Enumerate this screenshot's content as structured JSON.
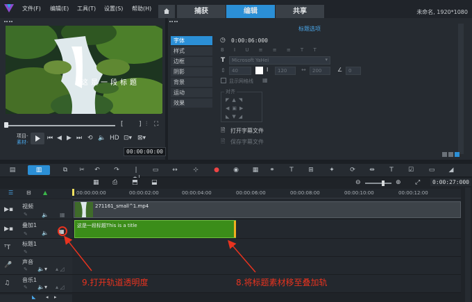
{
  "menu": [
    "文件(F)",
    "编辑(E)",
    "工具(T)",
    "设置(S)",
    "帮助(H)"
  ],
  "tabs": [
    "捕获",
    "编辑",
    "共享"
  ],
  "project_info": "未命名, 1920*1080",
  "player": {
    "subtitle": "这是一段标题",
    "mode_project": "项目-",
    "mode_clip": "素材-",
    "timecode": "00:00:00:00"
  },
  "options": {
    "title": "标题选项",
    "categories": [
      "字体",
      "样式",
      "边框",
      "阴影",
      "背景",
      "运动",
      "效果"
    ],
    "duration": "0:00:06:000",
    "font_name": "Microsoft YaHei",
    "font_size": "40",
    "line_spacing": "120",
    "char_spacing": "200",
    "angle": "0",
    "show_grid": "显示网格线",
    "align_label": "对齐",
    "open_subtitle": "打开字幕文件",
    "save_subtitle": "保存字幕文件"
  },
  "timeline": {
    "ruler": [
      "00:00:00:00",
      "00:00:02:00",
      "00:00:04:00",
      "00:00:06:00",
      "00:00:08:00",
      "00:00:10:00",
      "00:00:12:00"
    ],
    "zoom_timecode": "0:00:27:000",
    "tracks": [
      "视频",
      "叠加1",
      "标题1",
      "声音",
      "音乐1"
    ],
    "video_clip": "271161_small^1.mp4",
    "title_clip": "这是一段标题This is a title"
  },
  "annotations": {
    "left": "9.打开轨道透明度",
    "right": "8.将标题素材移至叠加轨"
  },
  "colors": {
    "accent_blue": "#2b8fd6",
    "title_clip_green": "#3b8d19",
    "annotation_red": "#e8331f"
  }
}
